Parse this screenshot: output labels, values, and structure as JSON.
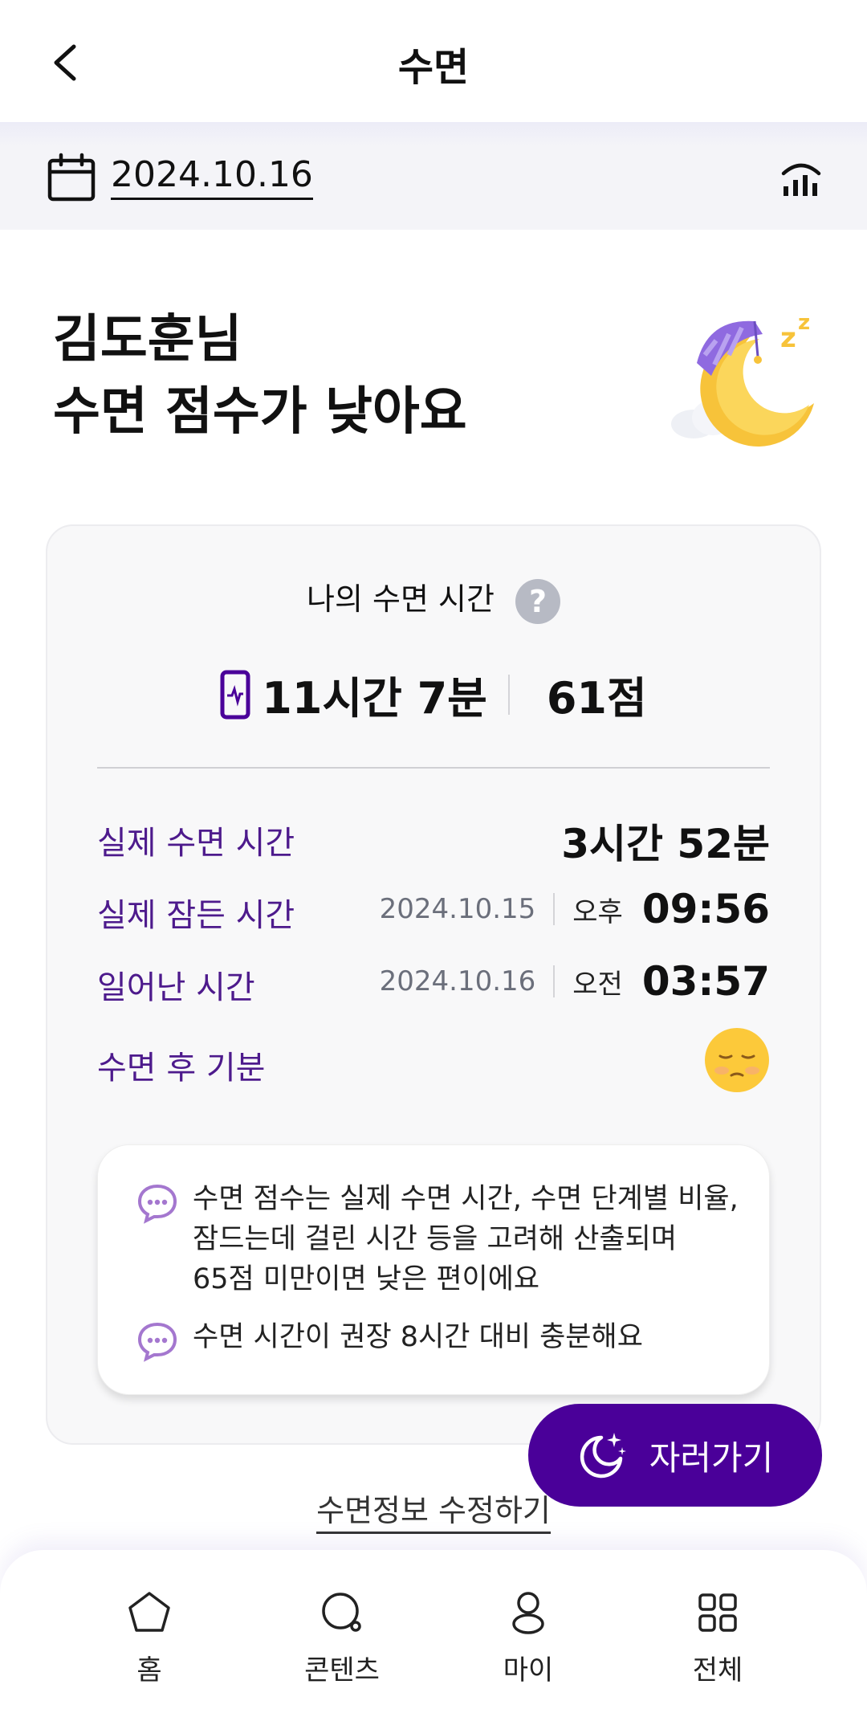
{
  "header": {
    "title": "수면",
    "back_icon": "chevron-left-icon"
  },
  "datebar": {
    "date": "2024.10.16",
    "calendar_icon": "calendar-icon",
    "stats_icon": "signal-bars-icon"
  },
  "greeting": {
    "line1": "김도훈님",
    "line2": "수면 점수가 낮아요",
    "illustration": "sleeping-moon-icon"
  },
  "card": {
    "title": "나의 수면 시간",
    "help": "?",
    "total_time": "11시간 7분",
    "score": "61점",
    "rows": [
      {
        "label": "실제 수면 시간",
        "value": "3시간 52분"
      },
      {
        "label": "실제 잠든 시간",
        "date": "2024.10.15",
        "ampm": "오후",
        "time": "09:56"
      },
      {
        "label": "일어난 시간",
        "date": "2024.10.16",
        "ampm": "오전",
        "time": "03:57"
      },
      {
        "label": "수면 후 기분",
        "mood_icon": "tired-face-icon"
      }
    ],
    "notes": [
      {
        "line1": "수면 점수는 실제 수면 시간, 수면 단계별 비율,",
        "line2": "잠드는데 걸린 시간 등을 고려해 산출되며",
        "line3": "65점 미만이면 낮은 편이에요"
      },
      {
        "line1": "수면 시간이 권장 8시간 대비 충분해요"
      }
    ]
  },
  "edit_link": "수면정보 수정하기",
  "fab": {
    "label": "자러가기",
    "icon": "moon-stars-icon"
  },
  "colors": {
    "accent": "#4a0099",
    "label": "#4d1a8c"
  },
  "bottom_nav": [
    {
      "label": "홈",
      "icon": "home-icon"
    },
    {
      "label": "콘텐츠",
      "icon": "search-icon"
    },
    {
      "label": "마이",
      "icon": "person-icon"
    },
    {
      "label": "전체",
      "icon": "grid-icon"
    }
  ]
}
